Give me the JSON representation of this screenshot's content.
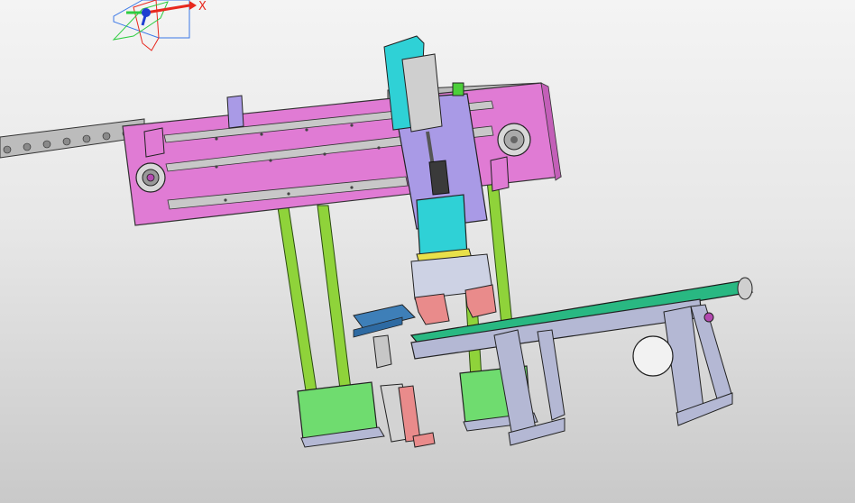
{
  "viewport": {
    "triad": {
      "x_axis_label": "X",
      "x_axis_color": "#e8281e",
      "y_axis_color": "#2ecc40",
      "z_axis_color": "#1f3fd1"
    }
  },
  "model": {
    "parts": [
      {
        "name": "chain-conveyor",
        "color": "#b5b5b5"
      },
      {
        "name": "slide-plate",
        "color": "#e07bd4"
      },
      {
        "name": "linear-rail",
        "color": "#c2c2c2"
      },
      {
        "name": "support-column",
        "color": "#8fd33a"
      },
      {
        "name": "column-base",
        "color": "#6fdc6f"
      },
      {
        "name": "lift-cylinder",
        "color": "#2fd1d6"
      },
      {
        "name": "carriage-plate",
        "color": "#a99ae6"
      },
      {
        "name": "gripper-jaw",
        "color": "#e98b8b"
      },
      {
        "name": "tray-fixture",
        "color": "#3e7fb8"
      },
      {
        "name": "belt-conveyor",
        "color": "#29b882"
      },
      {
        "name": "conveyor-frame",
        "color": "#b4b8d4"
      }
    ]
  }
}
